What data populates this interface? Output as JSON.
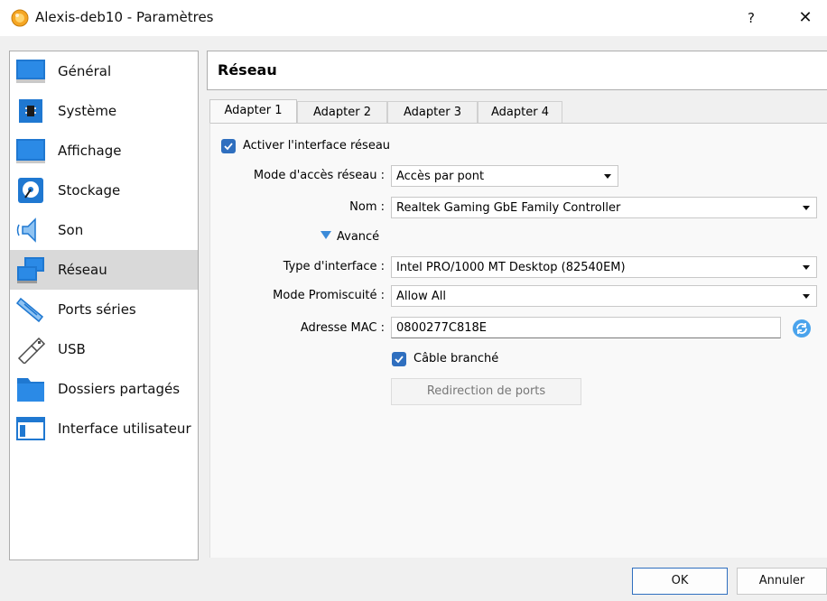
{
  "window": {
    "title": "Alexis-deb10 - Paramètres",
    "help_label": "?",
    "close_label": "✕"
  },
  "sidebar": {
    "items": [
      {
        "label": "Général",
        "icon": "general-icon"
      },
      {
        "label": "Système",
        "icon": "system-icon"
      },
      {
        "label": "Affichage",
        "icon": "display-icon"
      },
      {
        "label": "Stockage",
        "icon": "storage-icon"
      },
      {
        "label": "Son",
        "icon": "audio-icon"
      },
      {
        "label": "Réseau",
        "icon": "network-icon",
        "active": true
      },
      {
        "label": "Ports séries",
        "icon": "serial-ports-icon"
      },
      {
        "label": "USB",
        "icon": "usb-icon"
      },
      {
        "label": "Dossiers partagés",
        "icon": "shared-folders-icon"
      },
      {
        "label": "Interface utilisateur",
        "icon": "user-interface-icon"
      }
    ]
  },
  "panel": {
    "title": "Réseau",
    "tabs": [
      {
        "label": "Adapter 1",
        "active": true
      },
      {
        "label": "Adapter 2"
      },
      {
        "label": "Adapter 3"
      },
      {
        "label": "Adapter 4"
      }
    ],
    "enable_adapter": {
      "label": "Activer l'interface réseau",
      "checked": true
    },
    "attached_to": {
      "label": "Mode d'accès réseau :",
      "value": "Accès par pont"
    },
    "name": {
      "label": "Nom :",
      "value": "Realtek Gaming GbE Family Controller"
    },
    "advanced": {
      "label": "Avancé"
    },
    "adapter_type": {
      "label": "Type d'interface :",
      "value": "Intel PRO/1000 MT Desktop (82540EM)"
    },
    "promiscuous": {
      "label": "Mode Promiscuité :",
      "value": "Allow All"
    },
    "mac": {
      "label": "Adresse MAC :",
      "value": "0800277C818E"
    },
    "cable": {
      "label": "Câble branché",
      "checked": true
    },
    "port_forwarding": {
      "label": "Redirection de ports"
    }
  },
  "footer": {
    "ok_label": "OK",
    "cancel_label": "Annuler"
  },
  "colors": {
    "accent": "#2f6fbf",
    "selected_item": "#d9d9d9"
  }
}
